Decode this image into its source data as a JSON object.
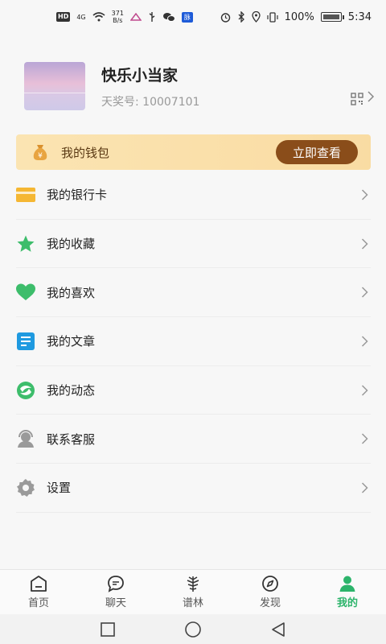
{
  "status": {
    "left_chip": "HD",
    "network": "4G",
    "speed_top": "371",
    "speed_unit": "B/s",
    "blue_badge": "脉",
    "battery": "100%",
    "time": "5:34"
  },
  "profile": {
    "name": "快乐小当家",
    "uid_label": "天奖号:",
    "uid": "10007101"
  },
  "wallet": {
    "label": "我的钱包",
    "button": "立即查看"
  },
  "menu": {
    "items": [
      {
        "label": "我的银行卡",
        "icon": "bank-card-icon"
      },
      {
        "label": "我的收藏",
        "icon": "star-icon"
      },
      {
        "label": "我的喜欢",
        "icon": "heart-icon"
      },
      {
        "label": "我的文章",
        "icon": "document-icon"
      },
      {
        "label": "我的动态",
        "icon": "moments-icon"
      },
      {
        "label": "联系客服",
        "icon": "customer-service-icon"
      },
      {
        "label": "设置",
        "icon": "settings-icon"
      }
    ]
  },
  "nav": {
    "items": [
      {
        "label": "首页",
        "icon": "home-icon"
      },
      {
        "label": "聊天",
        "icon": "chat-icon"
      },
      {
        "label": "谱林",
        "icon": "tree-icon"
      },
      {
        "label": "发现",
        "icon": "compass-icon"
      },
      {
        "label": "我的",
        "icon": "person-icon",
        "active": true
      }
    ]
  },
  "colors": {
    "accent": "#2db46b",
    "wallet_bg": "#f9dca3",
    "wallet_button": "#8a4d1a"
  }
}
